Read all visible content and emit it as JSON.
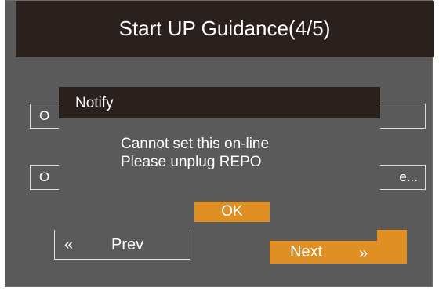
{
  "dialog": {
    "title": "Start UP Guidance(4/5)",
    "options": [
      {
        "left_text": "O",
        "right_text": ""
      },
      {
        "left_text": "O",
        "right_text": "e..."
      }
    ],
    "prev_label": "Prev",
    "prev_icon": "«",
    "next_label": "Next",
    "next_icon": "»"
  },
  "notify": {
    "title": "Notify",
    "message_line1": "Cannot set this on-line",
    "message_line2": "Please unplug REPO",
    "ok_label": "OK"
  },
  "colors": {
    "panel": "#5a5a5a",
    "header": "#2a201e",
    "accent": "#e08f22"
  }
}
